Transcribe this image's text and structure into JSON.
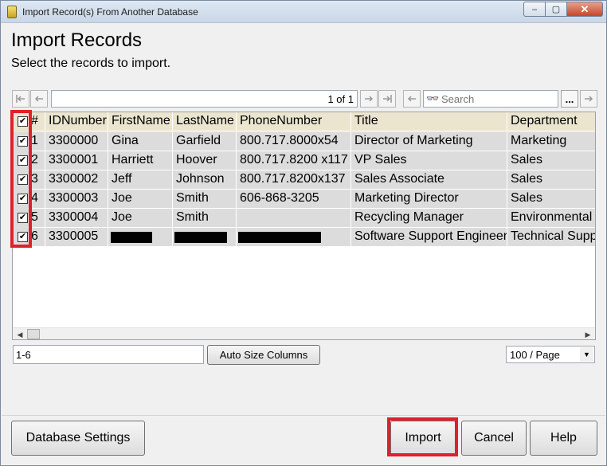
{
  "window": {
    "title": "Import Record(s) From Another Database",
    "controls": {
      "minimize": "–",
      "maximize": "▢",
      "close": "✕"
    }
  },
  "header": {
    "title": "Import Records",
    "subtitle": "Select the records to import."
  },
  "toolbar": {
    "first_icon": "first-page-icon",
    "prev_icon": "previous-page-icon",
    "page_indicator": "1 of 1",
    "next_icon": "next-page-icon",
    "last_icon": "last-page-icon",
    "back_icon": "back-icon",
    "search_placeholder": "Search",
    "search_icon": "binoculars-icon",
    "options_label": "...",
    "forward_icon": "forward-icon"
  },
  "grid": {
    "columns": [
      "#",
      "IDNumber",
      "FirstName",
      "LastName",
      "PhoneNumber",
      "Title",
      "Department"
    ],
    "header_checked": true,
    "rows": [
      {
        "checked": true,
        "num": "1",
        "id": "3300000",
        "first": "Gina",
        "last": "Garfield",
        "phone": "800.717.8000x54",
        "title": "Director of Marketing",
        "dept": "Marketing"
      },
      {
        "checked": true,
        "num": "2",
        "id": "3300001",
        "first": "Harriett",
        "last": "Hoover",
        "phone": "800.717.8200 x117",
        "title": "VP Sales",
        "dept": "Sales"
      },
      {
        "checked": true,
        "num": "3",
        "id": "3300002",
        "first": "Jeff",
        "last": "Johnson",
        "phone": "800.717.8200x137",
        "title": "Sales Associate",
        "dept": "Sales"
      },
      {
        "checked": true,
        "num": "4",
        "id": "3300003",
        "first": "Joe",
        "last": "Smith",
        "phone": "606-868-3205",
        "title": "Marketing Director",
        "dept": "Sales"
      },
      {
        "checked": true,
        "num": "5",
        "id": "3300004",
        "first": "Joe",
        "last": "Smith",
        "phone": "",
        "title": "Recycling Manager",
        "dept": "Environmental S"
      },
      {
        "checked": true,
        "num": "6",
        "id": "3300005",
        "first": "",
        "last": "",
        "phone": "",
        "title": "Software Support Engineer",
        "dept": "Technical Suppo"
      }
    ],
    "redacted_row": "6"
  },
  "footer": {
    "range_value": "1-6",
    "auto_size_label": "Auto Size Columns",
    "page_size": "100 / Page"
  },
  "actions": {
    "database_settings": "Database Settings",
    "import": "Import",
    "cancel": "Cancel",
    "help": "Help"
  },
  "colors": {
    "highlight": "#e0202a",
    "row_bg": "#dcdcdc",
    "header_bg": "#ebe5d0"
  }
}
